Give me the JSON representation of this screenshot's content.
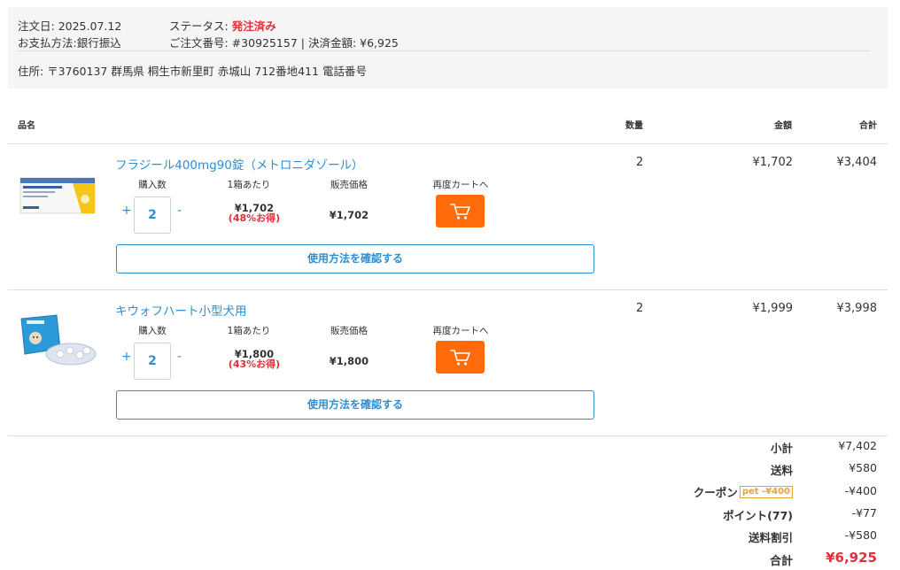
{
  "order": {
    "date_label": "注文日:",
    "date_value": "2025.07.12",
    "status_label": "ステータス:",
    "status_value": "発注済み",
    "payment_label": "お支払方法:",
    "payment_value": "銀行振込",
    "order_no_text": "ご注文番号: #30925157 | 決済金額: ¥6,925",
    "address_text": "住所: 〒3760137 群馬県 桐生市新里町  赤城山 712番地411  電話番号",
    "status_color": "#e0303a"
  },
  "table": {
    "col_product": "品名",
    "col_qty": "数量",
    "col_price": "金額",
    "col_total": "合計"
  },
  "items": [
    {
      "name": "フラジール400mg90錠（メトロニダゾール）",
      "qty_label": "購入数",
      "unit_label": "1箱あたり",
      "sale_label": "販売価格",
      "recart_label": "再度カートへ",
      "plus": "+",
      "minus": "-",
      "qty": "2",
      "unit_price": "¥1,702",
      "discount": "(48%お得)",
      "sale_price": "¥1,702",
      "usage_button": "使用方法を確認する",
      "col_qty": "2",
      "col_price": "¥1,702",
      "col_total": "¥3,404",
      "thumb_label": "Metronidazole Tablets I.P."
    },
    {
      "name": "キウォフハート小型犬用",
      "qty_label": "購入数",
      "unit_label": "1箱あたり",
      "sale_label": "販売価格",
      "recart_label": "再度カートへ",
      "plus": "+",
      "minus": "-",
      "qty": "2",
      "unit_price": "¥1,800",
      "discount": "(43%お得)",
      "sale_price": "¥1,800",
      "usage_button": "使用方法を確認する",
      "col_qty": "2",
      "col_price": "¥1,999",
      "col_total": "¥3,998",
      "thumb_label": "KIWOFF HEART"
    }
  ],
  "summary": {
    "subtotal_label": "小計",
    "subtotal_value": "¥7,402",
    "shipping_label": "送料",
    "shipping_value": "¥580",
    "coupon_label": "クーポン",
    "coupon_code": "pet -¥400",
    "coupon_value": "-¥400",
    "points_label": "ポイント(77)",
    "points_value": "-¥77",
    "shipping_discount_label": "送料割引",
    "shipping_discount_value": "-¥580",
    "total_label": "合計",
    "total_value": "¥6,925"
  },
  "colors": {
    "accent_blue": "#2f8fd0",
    "cart_orange": "#ff6a0a",
    "price_red": "#e0303a",
    "coupon_orange": "#e8a23a"
  }
}
